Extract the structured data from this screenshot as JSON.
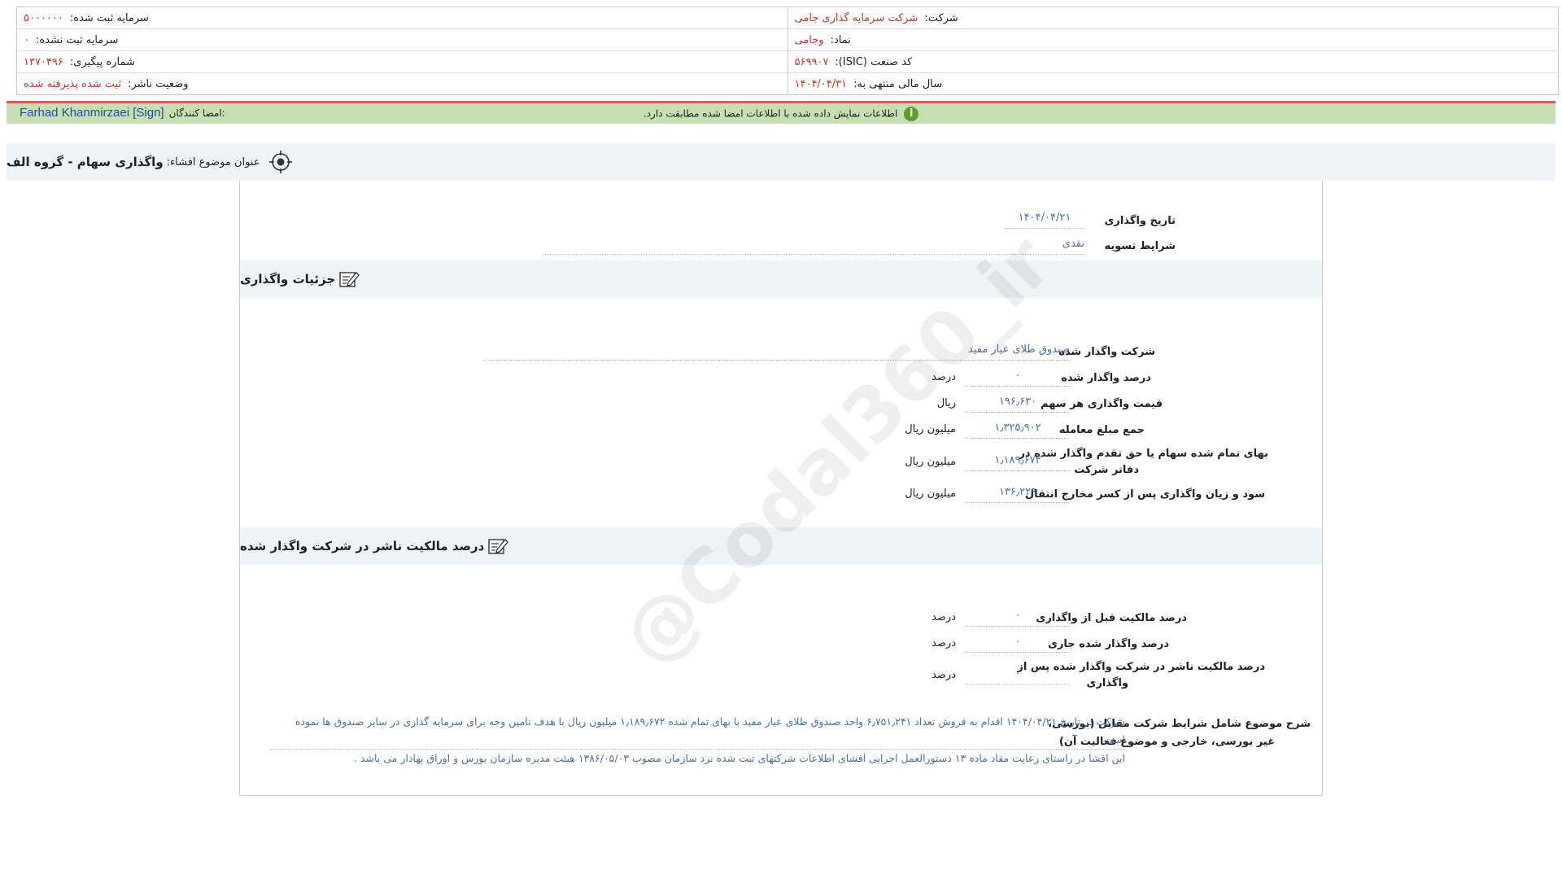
{
  "company_info": {
    "company_label": "شرکت:",
    "company_value": "شرکت سرمایه گذاری جامی",
    "symbol_label": "نماد:",
    "symbol_value": "وجامی",
    "isic_label": "کد صنعت (ISIC):",
    "isic_value": "۵۶۹۹۰۷",
    "fiscal_label": "سال مالی منتهی به:",
    "fiscal_value": "۱۴۰۴/۰۴/۳۱",
    "registered_capital_label": "سرمایه ثبت شده:",
    "registered_capital_value": "۵۰۰۰۰۰۰",
    "unregistered_capital_label": "سرمایه ثبت نشده:",
    "unregistered_capital_value": "۰",
    "tracking_label": "شماره پیگیری:",
    "tracking_value": "۱۳۷۰۴۹۶",
    "publisher_status_label": "وضعیت ناشر:",
    "publisher_status_value": "ثبت شده پذیرفته شده"
  },
  "signature_bar": {
    "signers_label": "امضا کنندگان:",
    "signer_name": "Farhad Khanmirzaei [Sign]",
    "verification_message": "اطلاعات نمایش داده شده با اطلاعات امضا شده مطابقت دارد.",
    "accent_color": "#e05a5a",
    "bg_color": "#c6e0b4"
  },
  "subject": {
    "label": "عنوان موضوع افشاء:",
    "title": "واگذاری سهام - گروه الف"
  },
  "transfer_basic": {
    "date_label": "تاریخ واگذاری",
    "date_value": "۱۴۰۴/۰۴/۲۱",
    "settlement_label": "شرایط تسویه",
    "settlement_value": "نقدی"
  },
  "transfer_details": {
    "title": "جزئیات واگذاری",
    "transferred_company_label": "شرکت واگذار شده",
    "transferred_company_value": "صندوق طلای عیار مفید",
    "percent_label": "درصد واگذار شده",
    "percent_value": "۰",
    "percent_unit": "درصد",
    "price_label": "قیمت واگذاری هر سهم",
    "price_value": "۱۹۶٫۶۳۰",
    "price_unit": "ریال",
    "total_label": "جمع مبلغ معامله",
    "total_value": "۱٫۳۲۵٫۹۰۲",
    "total_unit": "میلیون ریال",
    "cost_label_1": "بهای تمام شده سهام یا حق تقدم واگذار شده در",
    "cost_label_2": "دفاتر شرکت",
    "cost_value": "۱٫۱۸۹٫۶۷۲",
    "cost_unit": "میلیون ریال",
    "profit_label": "سود و زیان واگذاری پس از کسر مخارج انتقال",
    "profit_value": "۱۳۶٫۲۲۹",
    "profit_unit": "میلیون ریال"
  },
  "ownership": {
    "title": "درصد مالکیت ناشر در شرکت واگذار شده",
    "before_label": "درصد مالکیت قبل از واگذاری",
    "before_value": "۰",
    "before_unit": "درصد",
    "current_label": "درصد واگذار شده جاری",
    "current_value": "۰",
    "current_unit": "درصد",
    "after_label_1": "درصد مالکیت ناشر در شرکت واگذار شده پس از",
    "after_label_2": "واگذاری",
    "after_value": "۰",
    "after_unit": "درصد"
  },
  "description": {
    "label_1": "شرح موضوع شامل شرایط شرکت مقابل (بورسی،",
    "label_2": "غیر بورسی، خارجی و موضوع فعالیت آن)",
    "text_1": "شرکت در تاریخ ۱۴۰۴/۰۴/۲۱ اقدام به فروش تعداد ۶٫۷۵۱٫۲۴۱ واحد صندوق طلای عیار مفید با بهای تمام شده ۱٫۱۸۹٫۶۷۲ میلیون ریال با هدف تامین وجه برای سرمایه گذاری در سایر صندوق ها نموده است.",
    "text_2": "این افشا در راستای رعایت مفاد ماده ۱۳ دستورالعمل اجرایی افشای اطلاعات شرکتهای ثبت شده نزد سازمان مصوب ۱۳۸۶/۰۵/۰۳ هیئت مدیره سازمان بورس و اوراق بهادار می باشد ."
  },
  "watermark": {
    "text": "@Codal360_ir"
  },
  "icons": {
    "subject_icon": "target-icon",
    "section_icon": "edit-document-icon",
    "verify_icon": "info-check-icon"
  }
}
